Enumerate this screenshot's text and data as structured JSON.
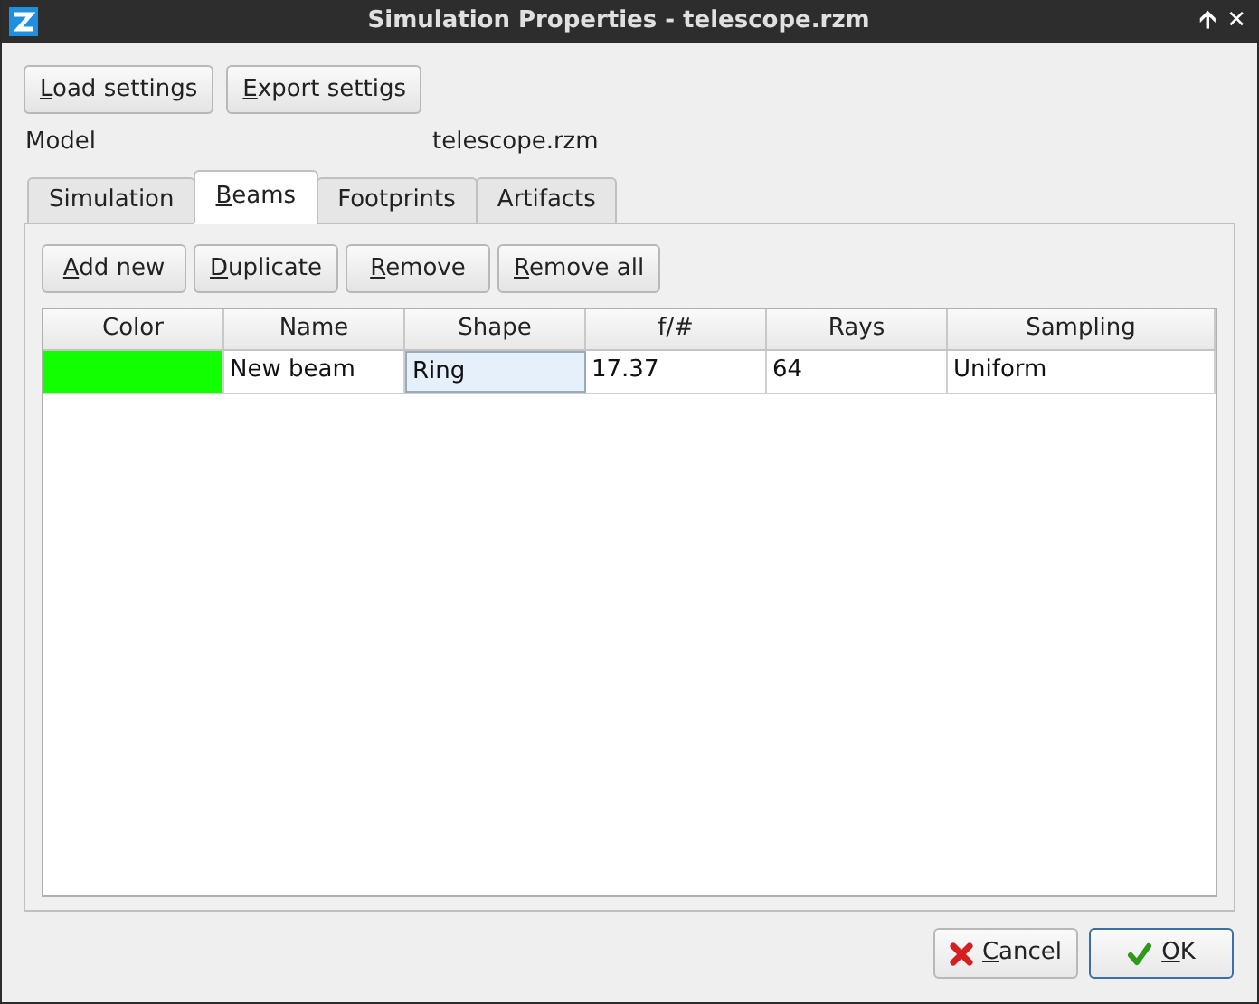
{
  "window": {
    "title": "Simulation Properties - telescope.rzm",
    "controls": [
      "🡩",
      "✕"
    ]
  },
  "top_buttons": [
    {
      "label": "Load settings",
      "mnemonic": true
    },
    {
      "label": "Export settigs",
      "mnemonic": true
    }
  ],
  "model": {
    "label": "Model",
    "value": "telescope.rzm"
  },
  "tabs": [
    {
      "label": "Simulation",
      "selected": false,
      "mnemonic": false
    },
    {
      "label": "Beams",
      "selected": true,
      "mnemonic": true
    },
    {
      "label": "Footprints",
      "selected": false,
      "mnemonic": false
    },
    {
      "label": "Artifacts",
      "selected": false,
      "mnemonic": false
    }
  ],
  "beam_buttons": [
    {
      "label": "Add new",
      "mnemonic": true
    },
    {
      "label": "Duplicate",
      "mnemonic": true
    },
    {
      "label": "Remove",
      "mnemonic": true
    },
    {
      "label": "Remove all",
      "mnemonic": true
    }
  ],
  "table": {
    "columns": [
      "Color",
      "Name",
      "Shape",
      "f/#",
      "Rays",
      "Sampling"
    ],
    "rows": [
      {
        "cells": [
          {
            "kind": "swatch",
            "color": "#11ff00"
          },
          {
            "kind": "text",
            "text": "New beam",
            "focused": false
          },
          {
            "kind": "text",
            "text": "Ring",
            "focused": true
          },
          {
            "kind": "text",
            "text": "17.37",
            "focused": false
          },
          {
            "kind": "text",
            "text": "64",
            "focused": false
          },
          {
            "kind": "text",
            "text": "Uniform",
            "focused": false
          }
        ]
      }
    ]
  },
  "dialog_buttons": [
    {
      "label": "Cancel",
      "kind": "cancel",
      "default": false
    },
    {
      "label": "OK",
      "kind": "ok",
      "default": true
    }
  ]
}
